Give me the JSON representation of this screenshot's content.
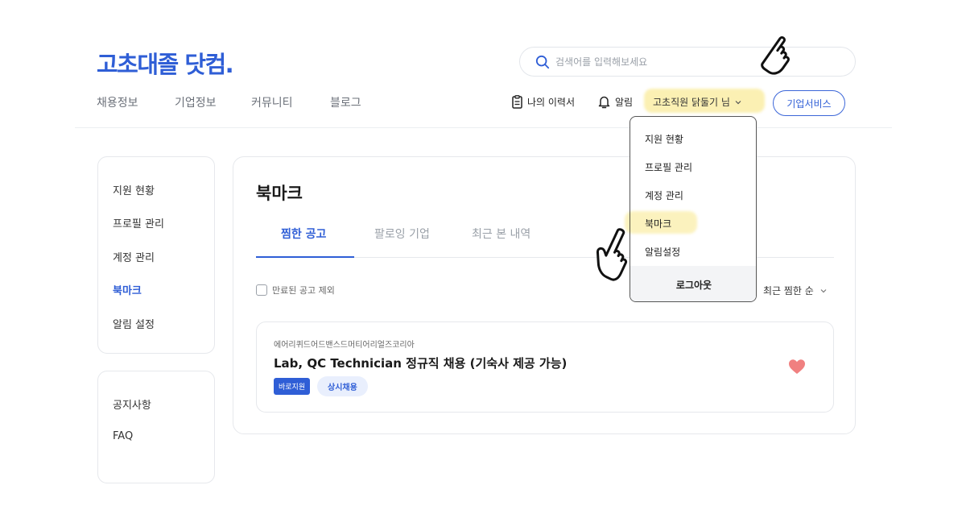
{
  "header": {
    "logo": "고초대졸 닷컴.",
    "search_placeholder": "검색어를 입력해보세요",
    "nav": [
      "채용정보",
      "기업정보",
      "커뮤니티",
      "블로그"
    ],
    "resume_label": "나의 이력서",
    "alarm_label": "알림",
    "user_label": "고초직원 닭둘기 님",
    "business_label": "기업서비스"
  },
  "dropdown": {
    "items": [
      "지원 현황",
      "프로필 관리",
      "계정 관리",
      "북마크",
      "알림설정"
    ],
    "logout": "로그아웃"
  },
  "sidebar": {
    "items": [
      "지원 현황",
      "프로필 관리",
      "계정 관리",
      "북마크",
      "알림 설정"
    ],
    "active_index": 3,
    "support": [
      "공지사항",
      "FAQ"
    ]
  },
  "main": {
    "title": "북마크",
    "tabs": [
      "찜한 공고",
      "팔로잉 기업",
      "최근 본 내역"
    ],
    "active_tab": 0,
    "exclude_expired_label": "만료된 공고 제외",
    "exclude_expired_checked": false,
    "sort_label": "최근 찜한 순",
    "jobs": [
      {
        "company": "에어리퀴드어드밴스드머티어리얼즈코리아",
        "title": "Lab, QC Technician 정규직 채용 (기숙사 제공 가능)",
        "badges": [
          "바로지원",
          "상시채용"
        ],
        "bookmarked": true
      }
    ]
  },
  "colors": {
    "brand": "#2f5ed6",
    "highlight": "#fbf0b3",
    "heart": "#f08080"
  }
}
